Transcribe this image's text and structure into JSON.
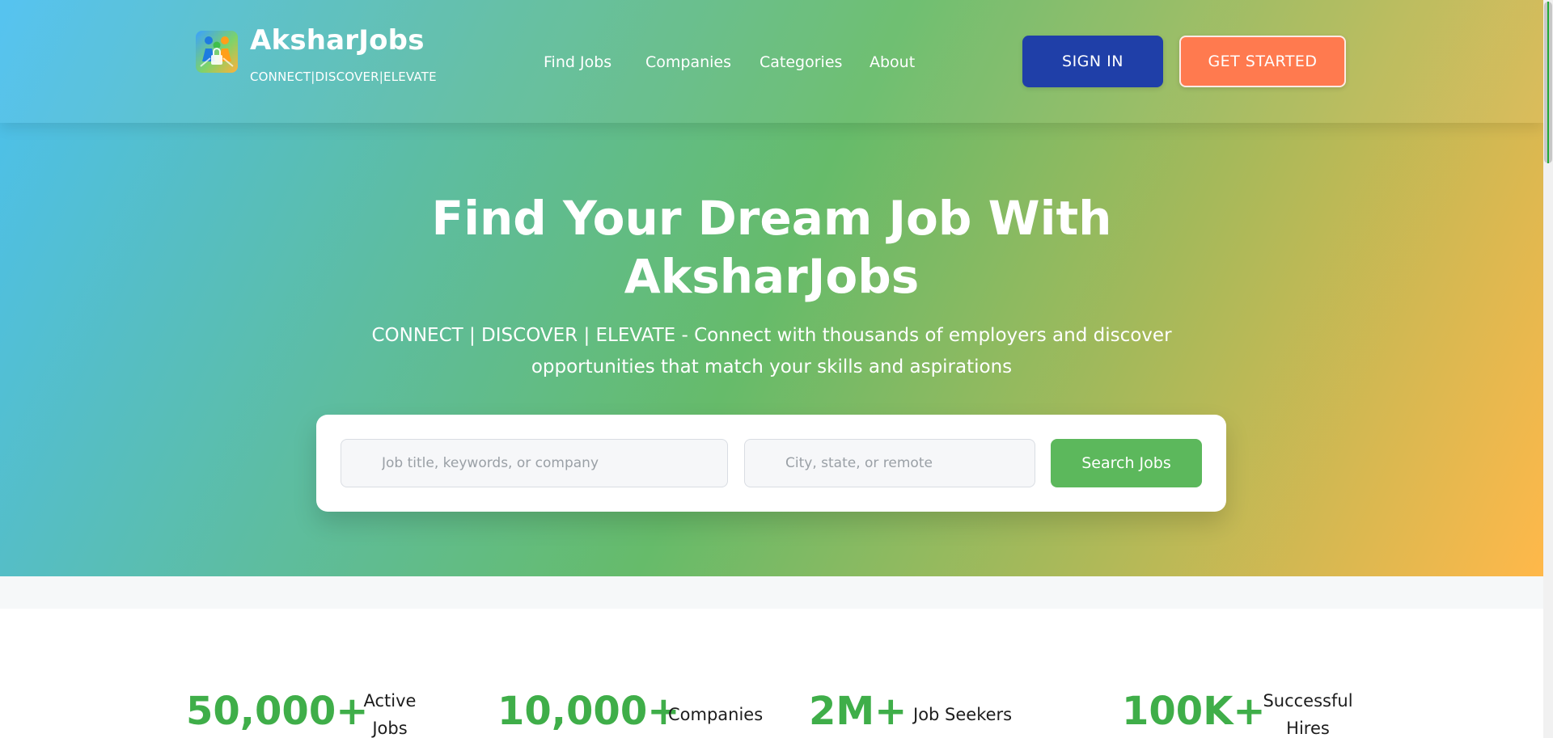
{
  "brand": {
    "name": "AksharJobs",
    "tagline": "CONNECT|DISCOVER|ELEVATE",
    "logo_icon": "people-with-lock-logo"
  },
  "nav": {
    "items": [
      {
        "label": "Find Jobs"
      },
      {
        "label": "Companies"
      },
      {
        "label": "Categories"
      },
      {
        "label": "About"
      }
    ]
  },
  "header_buttons": {
    "sign_in": "SIGN IN",
    "get_started": "GET STARTED"
  },
  "hero": {
    "title_line1": "Find Your Dream Job With",
    "title_line2": "AksharJobs",
    "subtitle_line1": "CONNECT | DISCOVER | ELEVATE - Connect with thousands of employers and discover",
    "subtitle_line2": "opportunities that match your skills and aspirations"
  },
  "search": {
    "keyword_placeholder": "Job title, keywords, or company",
    "location_placeholder": "City, state, or remote",
    "button_label": "Search Jobs"
  },
  "stats": [
    {
      "number": "50,000+",
      "label_line1": "Active",
      "label_line2": "Jobs"
    },
    {
      "number": "10,000+",
      "label_line1": "Companies",
      "label_line2": ""
    },
    {
      "number": "2M+",
      "label_line1": "Job Seekers",
      "label_line2": ""
    },
    {
      "number": "100K+",
      "label_line1": "Successful",
      "label_line2": "Hires"
    }
  ],
  "colors": {
    "gradient_start": "#4cc0f0",
    "gradient_mid": "#66bb6a",
    "gradient_end": "#ffb84a",
    "sign_in_bg": "#1f3fa8",
    "get_started_bg": "#ff7a4f",
    "search_button_bg": "#5cb85c",
    "stat_number": "#3fae49"
  }
}
